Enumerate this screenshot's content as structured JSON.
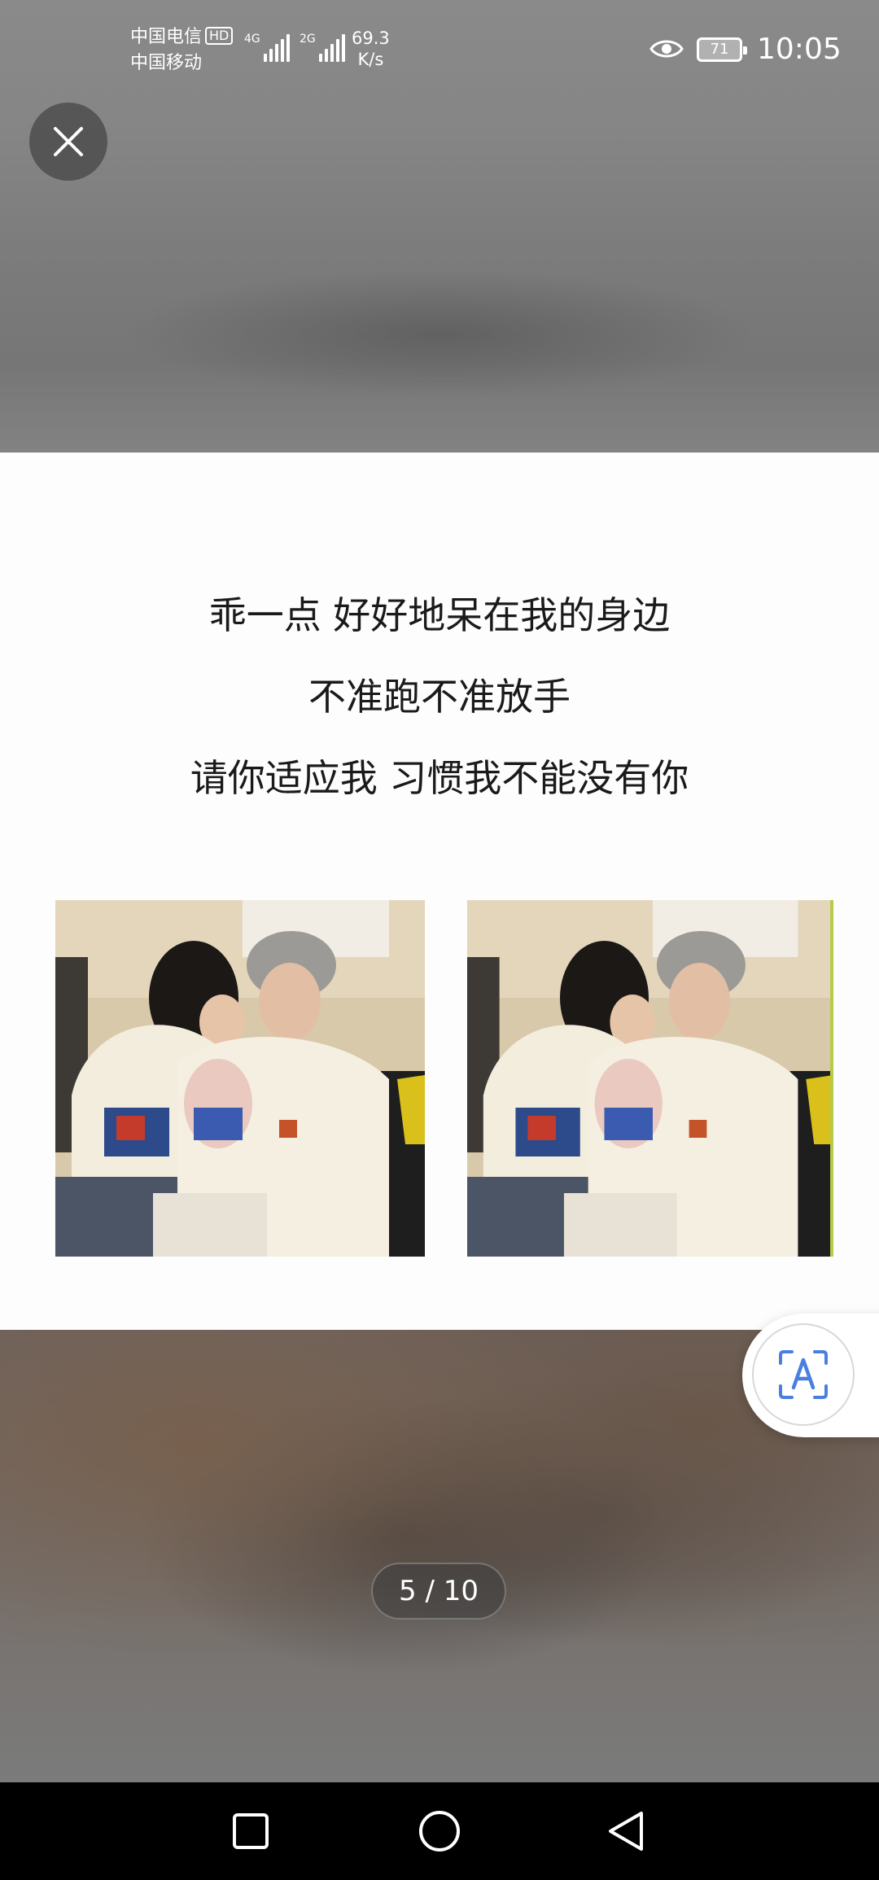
{
  "status_bar": {
    "carrier_1": "中国电信",
    "hd_badge": "HD",
    "carrier_2": "中国移动",
    "sim1_network": "4G",
    "sim2_network": "2G",
    "speed_value": "69.3",
    "speed_unit": "K/s",
    "battery_level": "71",
    "time": "10:05"
  },
  "viewer": {
    "close_icon": "close-icon",
    "page_counter": "5 / 10",
    "translate_icon": "scan-text-icon"
  },
  "post": {
    "lyrics": [
      "乖一点 好好地呆在我的身边",
      "不准跑不准放手",
      "请你适应我 习惯我不能没有你"
    ]
  },
  "nav_bar": {
    "recent_icon": "square-icon",
    "home_icon": "circle-icon",
    "back_icon": "triangle-back-icon"
  }
}
